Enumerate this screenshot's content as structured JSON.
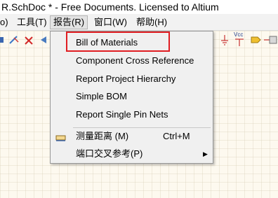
{
  "window": {
    "title": "R.SchDoc * - Free Documents. Licensed to Altium"
  },
  "menubar": {
    "items": [
      {
        "label": "o)"
      },
      {
        "label": "工具(T)"
      },
      {
        "label": "报告(R)"
      },
      {
        "label": "窗口(W)"
      },
      {
        "label": "帮助(H)"
      }
    ]
  },
  "toolbar": {
    "vcc_label": "Vcc"
  },
  "report_menu": {
    "items": [
      {
        "label": "Bill of Materials",
        "highlighted": true
      },
      {
        "label": "Component Cross Reference"
      },
      {
        "label": "Report Project Hierarchy"
      },
      {
        "label": "Simple BOM"
      },
      {
        "label": "Report Single Pin Nets"
      },
      {
        "label": "测量距离 (M)",
        "shortcut": "Ctrl+M"
      },
      {
        "label": "端口交叉参考(P)",
        "has_submenu": true
      }
    ]
  },
  "colors": {
    "highlight_border": "#e01d22",
    "menu_bg": "#f0f0f0",
    "sheet_bg": "#fdf9ef"
  }
}
